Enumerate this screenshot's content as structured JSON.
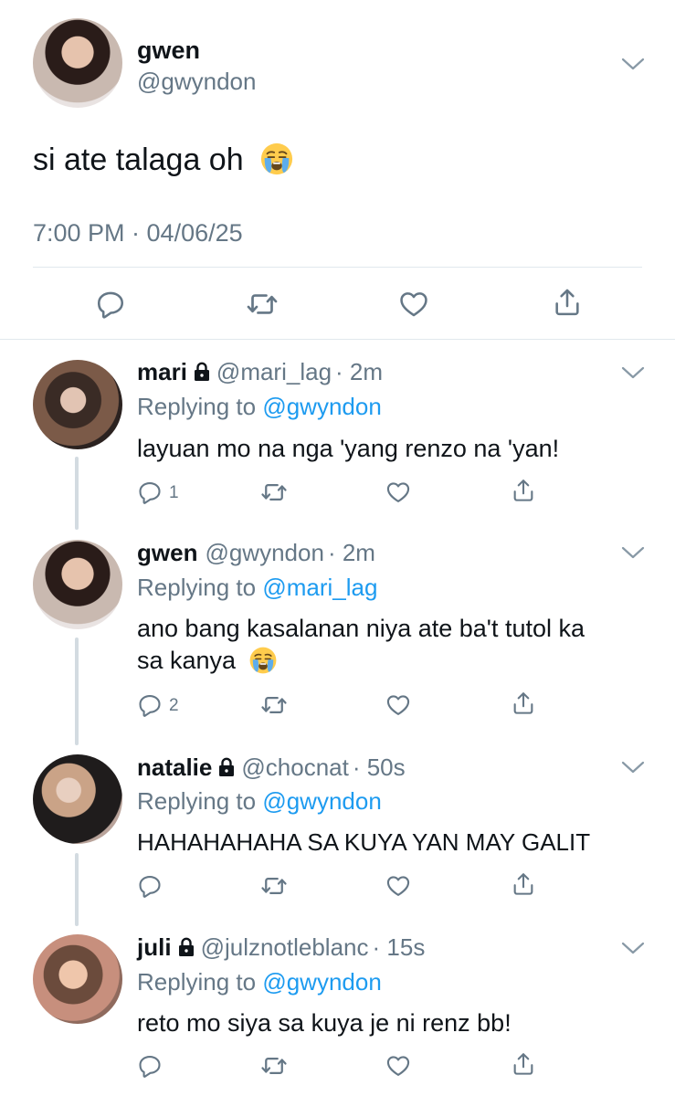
{
  "tweet": {
    "name": "gwen",
    "handle": "@gwyndon",
    "text": "si ate talaga oh",
    "timestamp": "7:00 PM · 04/06/25"
  },
  "replies": [
    {
      "name": "mari",
      "handle": "@mari_lag",
      "time": "· 2m",
      "locked": true,
      "replying_label": "Replying to",
      "replying_to": "@gwyndon",
      "text_lines": [
        "layuan mo na nga 'yang renzo na 'yan!"
      ],
      "reply_count": "1"
    },
    {
      "name": "gwen",
      "handle": "@gwyndon",
      "time": "· 2m",
      "locked": false,
      "replying_label": "Replying to",
      "replying_to": "@mari_lag",
      "text_lines": [
        "ano bang kasalanan niya ate ba't tutol ka",
        "sa kanya"
      ],
      "reply_count": "2"
    },
    {
      "name": "natalie",
      "handle": "@chocnat",
      "time": "· 50s",
      "locked": true,
      "replying_label": "Replying to",
      "replying_to": "@gwyndon",
      "text_lines": [
        "HAHAHAHAHA SA KUYA YAN MAY GALIT"
      ],
      "reply_count": ""
    },
    {
      "name": "juli",
      "handle": "@julznotleblanc",
      "time": "· 15s",
      "locked": true,
      "replying_label": "Replying to",
      "replying_to": "@gwyndon",
      "text_lines": [
        "reto mo siya sa kuya je ni renz bb!"
      ],
      "reply_count": ""
    }
  ],
  "icons": {
    "reply": "reply-icon",
    "retweet": "retweet-icon",
    "like": "heart-icon",
    "share": "share-icon",
    "more": "chevron-down-icon",
    "lock": "lock-icon",
    "emoji": "loudly-crying-face"
  },
  "colors": {
    "link": "#1d9bf0",
    "muted": "#657786",
    "divider": "#e1e8ed"
  }
}
